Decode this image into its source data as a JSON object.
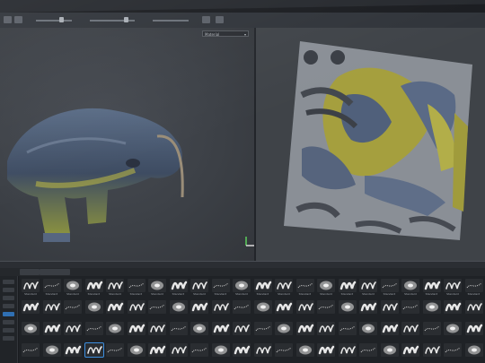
{
  "menu": {
    "items": [
      "",
      "",
      "",
      ""
    ]
  },
  "viewport": {
    "view_select_value": "Material"
  },
  "brush_library": {
    "header_count": "",
    "tabs": [
      "",
      "",
      ""
    ],
    "brush_labels": [
      "Standard",
      "Standard",
      "Standard",
      "Standard",
      "Standard",
      "Standard",
      "Standard",
      "Standard",
      "Standard",
      "Standard",
      "Standard",
      "Standard",
      "Standard",
      "Standard",
      "Standard",
      "Standard",
      "Standard",
      "Standard",
      "Standard",
      "Standard",
      "Standard",
      "Standard",
      "",
      "",
      "",
      "",
      "",
      "",
      "",
      "",
      "",
      "",
      "",
      "",
      "",
      "",
      "",
      "",
      "",
      "",
      "",
      "",
      "",
      "",
      "",
      "",
      "",
      "",
      "",
      "",
      "",
      "",
      "",
      "",
      "",
      "",
      "",
      "",
      "",
      "",
      "",
      "",
      "",
      "",
      "",
      "",
      "",
      "",
      "",
      "",
      "",
      "",
      "",
      "",
      "",
      "",
      "",
      "",
      "",
      "",
      "",
      "",
      "",
      "",
      "",
      "",
      "",
      ""
    ],
    "selected_index": 69
  },
  "colors": {
    "selection": "#3d8fe0",
    "mesh_blue": "#4c5d78",
    "mesh_yellow": "#b9b63a"
  }
}
